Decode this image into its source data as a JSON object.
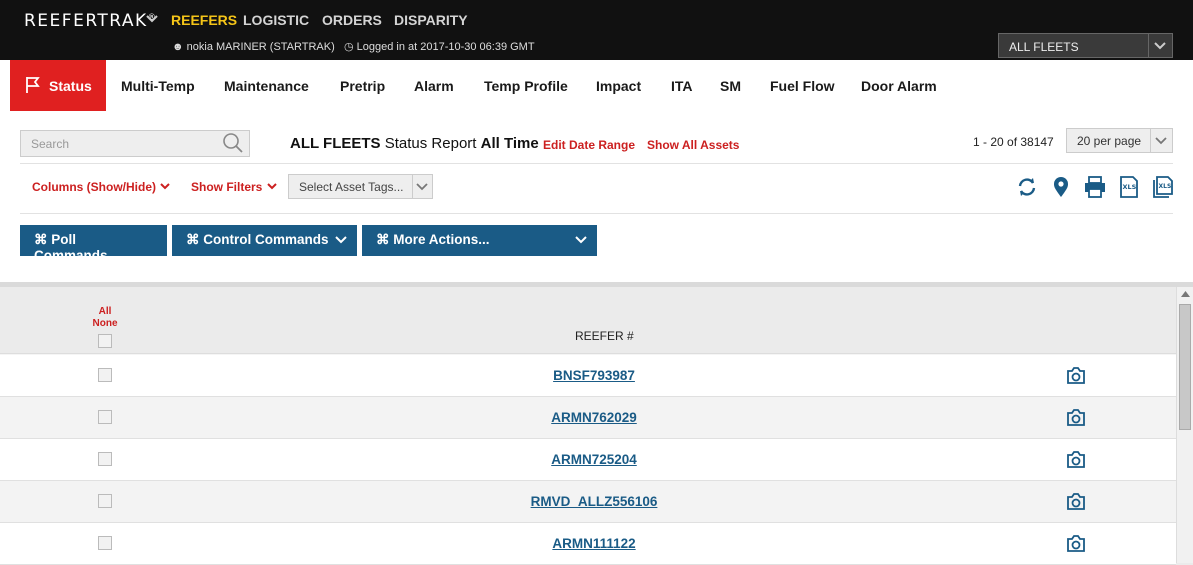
{
  "header": {
    "brand": "REEFERTRAK",
    "brand_mark": "®",
    "nav": [
      "REEFERS",
      "LOGISTIC",
      "ORDERS",
      "DISPARITY"
    ],
    "active_nav": "REEFERS",
    "user": "nokia MARINER (STARTRAK)",
    "login_info": "Logged in at 2017-10-30 06:39 GMT",
    "fleet_select": "ALL FLEETS",
    "accent_color": "#f5c518"
  },
  "tabs": {
    "active": "Status",
    "items": [
      "Multi-Temp",
      "Maintenance",
      "Pretrip",
      "Alarm",
      "Temp Profile",
      "Impact",
      "ITA",
      "SM",
      "Fuel Flow",
      "Door Alarm"
    ],
    "active_color": "#e02020"
  },
  "toolbar": {
    "search_placeholder": "Search",
    "report_fleet": "ALL FLEETS",
    "report_label": "Status Report",
    "report_range": "All Time",
    "edit_date_range": "Edit Date Range",
    "show_all_assets": "Show All Assets",
    "record_count": "1 - 20 of 38147",
    "per_page": "20 per page",
    "columns_toggle": "Columns (Show/Hide)",
    "show_filters": "Show Filters",
    "asset_tags_placeholder": "Select Asset Tags...",
    "icons": [
      "refresh-icon",
      "map-pin-icon",
      "print-icon",
      "xls-export-icon",
      "xls-export-all-icon"
    ]
  },
  "actions": {
    "poll": "⌘ Poll Commands",
    "control": "⌘ Control Commands",
    "more": "⌘ More Actions...",
    "button_color": "#1a5b86"
  },
  "table": {
    "select_all": "All",
    "select_none": "None",
    "column_header": "REEFER #",
    "rows": [
      "BNSF793987",
      "ARMN762029",
      "ARMN725204",
      "RMVD_ALLZ556106",
      "ARMN111122"
    ]
  }
}
